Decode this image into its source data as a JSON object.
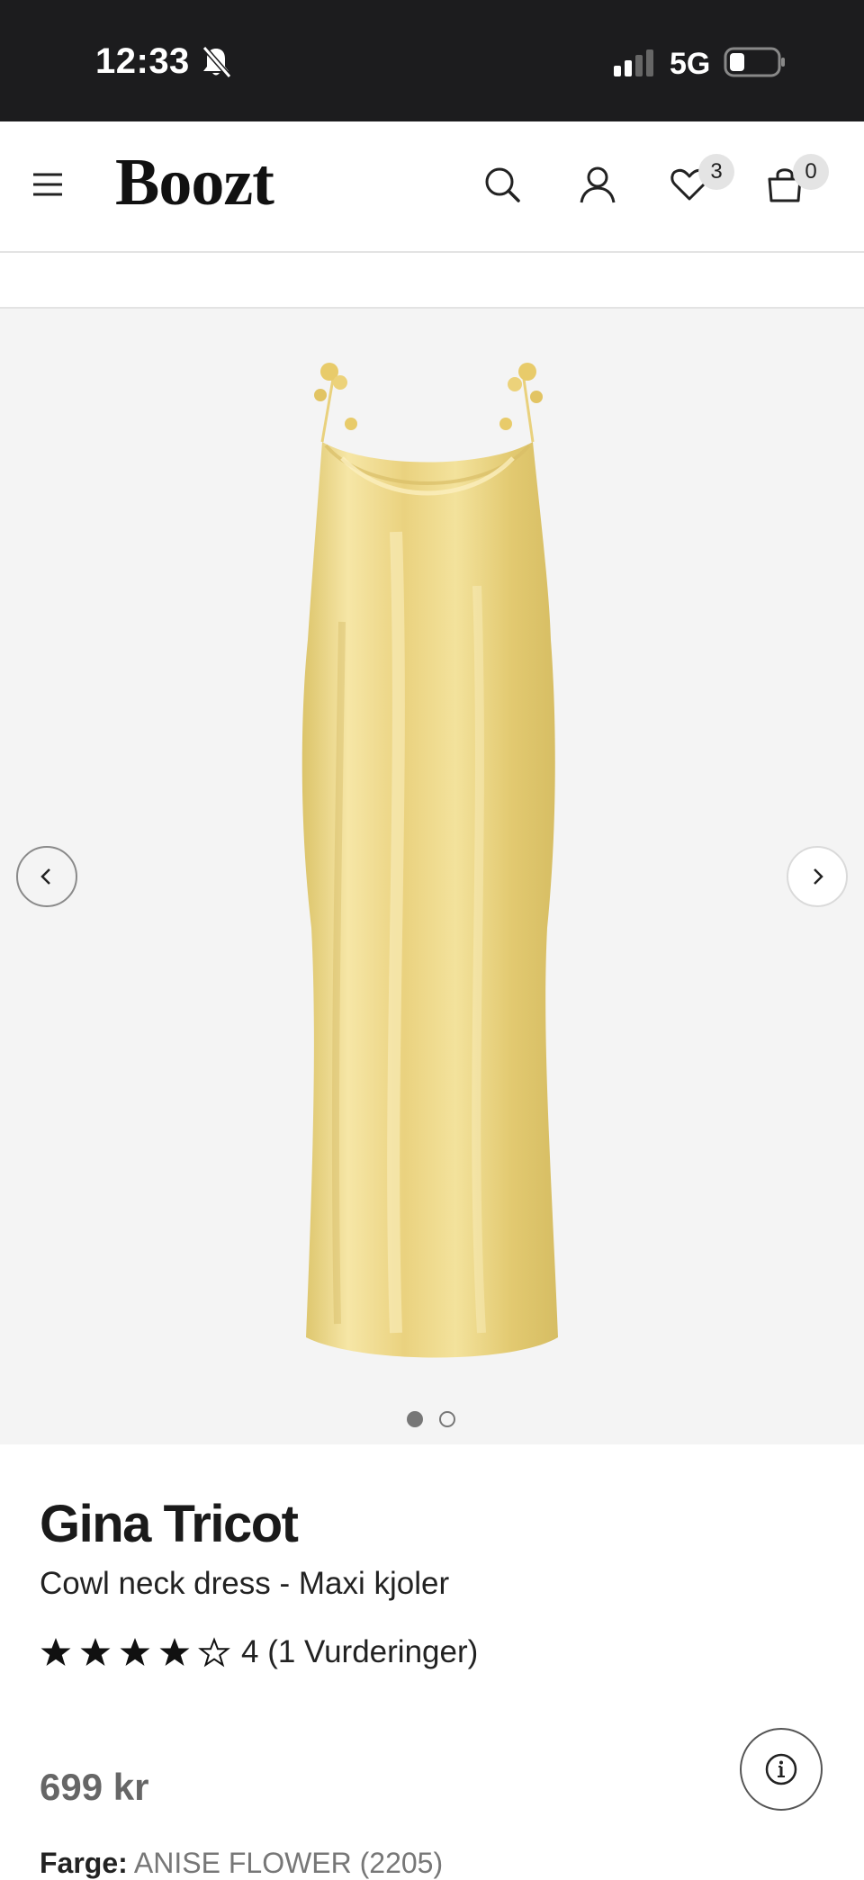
{
  "status_bar": {
    "time": "12:33",
    "network": "5G",
    "icons": [
      "bell-slash-icon",
      "signal-icon",
      "battery-icon"
    ]
  },
  "header": {
    "logo": "Boozt",
    "icons": [
      "menu-icon",
      "search-icon",
      "account-icon",
      "heart-icon",
      "shopping-bag-icon"
    ],
    "wishlist_count": "3",
    "bag_count": "0"
  },
  "gallery": {
    "image_alt": "Yellow satin cowl neck maxi dress",
    "current_slide": 1,
    "total_slides": 2
  },
  "product": {
    "brand": "Gina Tricot",
    "name": "Cowl neck dress - Maxi kjoler",
    "rating_value": 4,
    "rating_max": 5,
    "rating_text": "4 (1 Vurderinger)",
    "price": "699 kr",
    "color_label": "Farge:",
    "color_value": "ANISE FLOWER (2205)"
  },
  "colors": {
    "status_bar_bg": "#1c1c1e",
    "gallery_bg": "#f4f4f4",
    "dress": "#efd98a"
  }
}
